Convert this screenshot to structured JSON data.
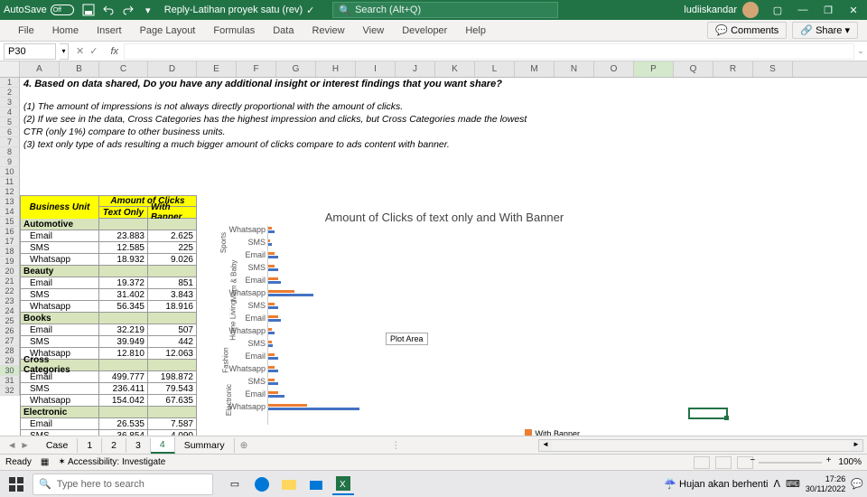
{
  "titlebar": {
    "autosave": "AutoSave",
    "autosave_state": "Off",
    "doc": "Reply-Latihan proyek satu (rev)",
    "search_placeholder": "Search (Alt+Q)",
    "user": "ludiiskandar"
  },
  "ribbon": {
    "tabs": [
      "File",
      "Home",
      "Insert",
      "Page Layout",
      "Formulas",
      "Data",
      "Review",
      "View",
      "Developer",
      "Help"
    ],
    "comments": "Comments",
    "share": "Share"
  },
  "namebox": "P30",
  "columns": [
    "A",
    "B",
    "C",
    "D",
    "E",
    "F",
    "G",
    "H",
    "I",
    "J",
    "K",
    "L",
    "M",
    "N",
    "O",
    "P",
    "Q",
    "R",
    "S"
  ],
  "rowlabels": [
    "1",
    "2",
    "3",
    "4",
    "5",
    "6",
    "7",
    "8",
    "9",
    "10",
    "11",
    "12",
    "13",
    "14",
    "15",
    "16",
    "17",
    "18",
    "19",
    "20",
    "21",
    "22",
    "23",
    "24",
    "25",
    "26",
    "27",
    "28",
    "29",
    "30",
    "31",
    "32"
  ],
  "content": {
    "question": "4. Based on data shared, Do you have any additional insight or interest findings that you want share?",
    "a1": "(1) The amount of impressions is not always directly proportional with the amount of clicks.",
    "a2": "(2) If we see in the data, Cross Categories has the highest impression and clicks, but Cross Categories made the lowest",
    "a3": "CTR (only 1%) compare to other business units.",
    "a4": "(3) text only type of ads resulting a much bigger amount of clicks compare to ads content with banner."
  },
  "table": {
    "h_bu": "Business Unit",
    "h_aoc": "Amount of Clicks",
    "h_to": "Text Only",
    "h_wb": "With Banner",
    "groups": [
      {
        "name": "Automotive",
        "rows": [
          {
            "label": "Email",
            "to": "23.883",
            "wb": "2.625"
          },
          {
            "label": "SMS",
            "to": "12.585",
            "wb": "225"
          },
          {
            "label": "Whatsapp",
            "to": "18.932",
            "wb": "9.026"
          }
        ]
      },
      {
        "name": "Beauty",
        "rows": [
          {
            "label": "Email",
            "to": "19.372",
            "wb": "851"
          },
          {
            "label": "SMS",
            "to": "31.402",
            "wb": "3.843"
          },
          {
            "label": "Whatsapp",
            "to": "56.345",
            "wb": "18.916"
          }
        ]
      },
      {
        "name": "Books",
        "rows": [
          {
            "label": "Email",
            "to": "32.219",
            "wb": "507"
          },
          {
            "label": "SMS",
            "to": "39.949",
            "wb": "442"
          },
          {
            "label": "Whatsapp",
            "to": "12.810",
            "wb": "12.063"
          }
        ]
      },
      {
        "name": "Cross Categories",
        "rows": [
          {
            "label": "Email",
            "to": "499.777",
            "wb": "198.872"
          },
          {
            "label": "SMS",
            "to": "236.411",
            "wb": "79.543"
          },
          {
            "label": "Whatsapp",
            "to": "154.042",
            "wb": "67.635"
          }
        ]
      },
      {
        "name": "Electronic",
        "rows": [
          {
            "label": "Email",
            "to": "26.535",
            "wb": "7.587"
          },
          {
            "label": "SMS",
            "to": "36.854",
            "wb": "4.090"
          }
        ]
      }
    ]
  },
  "chart_data": {
    "type": "bar",
    "title": "Amount of Clicks of text only and With Banner",
    "orientation": "horizontal",
    "legend": [
      "With Banner"
    ],
    "plot_area_label": "Plot Area",
    "y_groups": [
      "Sports",
      "Mom & Baby",
      "Home Living",
      "Fashion",
      "Electronic"
    ],
    "categories": [
      "Whatsapp",
      "SMS",
      "Email",
      "SMS",
      "Email",
      "Whatsapp",
      "SMS",
      "Email",
      "Whatsapp",
      "SMS",
      "Email",
      "Whatsapp",
      "SMS",
      "Email",
      "Whatsapp"
    ],
    "series": [
      {
        "name": "With Banner",
        "color": "#ed7d31",
        "values": [
          1,
          0.5,
          2,
          2,
          3,
          8,
          2,
          3,
          1,
          1,
          2,
          2,
          2,
          3,
          12
        ]
      },
      {
        "name": "Text Only",
        "color": "#4472c4",
        "values": [
          2,
          1,
          3,
          3,
          4,
          14,
          3,
          4,
          2,
          1.5,
          3,
          3,
          3,
          5,
          28
        ]
      }
    ],
    "xlim": [
      0,
      100
    ]
  },
  "sheets": {
    "tabs": [
      "Case",
      "1",
      "2",
      "3",
      "4",
      "Summary"
    ],
    "active": "4"
  },
  "status": {
    "ready": "Ready",
    "access": "Accessibility: Investigate",
    "zoom": "100%"
  },
  "taskbar": {
    "search": "Type here to search",
    "weather": "Hujan akan berhenti",
    "time": "17:26",
    "date": "30/11/2022"
  }
}
